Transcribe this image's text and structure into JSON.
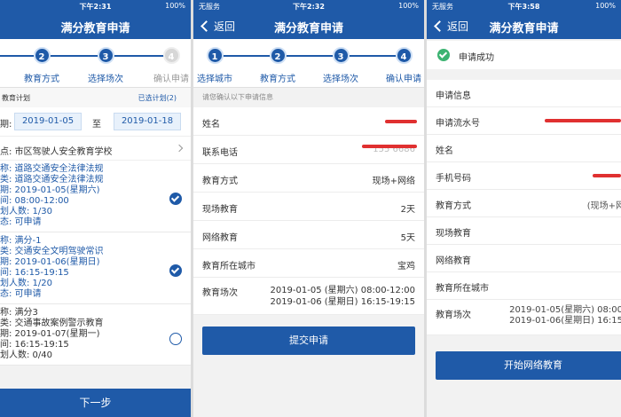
{
  "screen1": {
    "status": {
      "time": "下午2:31",
      "battery": "100%"
    },
    "title": "满分教育申请",
    "steps": [
      {
        "num": "2",
        "label": "教育方式"
      },
      {
        "num": "3",
        "label": "选择场次"
      },
      {
        "num": "4",
        "label": "确认申请"
      }
    ],
    "plan_header": "教育计划",
    "plan_selected": "已选计划(2)",
    "period_label": "期:",
    "date_from": "2019-01-05",
    "date_to_word": "至",
    "date_to": "2019-01-18",
    "school": "点: 市区驾驶人安全教育学校",
    "plans": [
      {
        "lines": [
          "称: 道路交通安全法律法规",
          "类: 道路交通安全法律法规",
          "期: 2019-01-05(星期六)",
          "间: 08:00-12:00",
          "划人数: 1/30",
          "态: 可申请"
        ],
        "checked": true
      },
      {
        "lines": [
          "称: 满分-1",
          "类: 交通安全文明驾驶常识",
          "期: 2019-01-06(星期日)",
          "间: 16:15-19:15",
          "划人数: 1/20",
          "态: 可申请"
        ],
        "checked": true
      },
      {
        "lines": [
          "称: 满分3",
          "类: 交通事故案例警示教育",
          "期: 2019-01-07(星期一)",
          "间: 16:15-19:15",
          "划人数: 0/40"
        ],
        "checked": false
      }
    ],
    "next_button": "下一步"
  },
  "screen2": {
    "status": {
      "carrier": "无服务",
      "time": "下午2:32",
      "battery": "100%"
    },
    "back": "返回",
    "title": "满分教育申请",
    "steps": [
      {
        "num": "1",
        "label": "选择城市"
      },
      {
        "num": "2",
        "label": "教育方式"
      },
      {
        "num": "3",
        "label": "选择场次"
      },
      {
        "num": "4",
        "label": "确认申请"
      }
    ],
    "confirm_hint": "请您确认以下申请信息",
    "fields": [
      {
        "key": "姓名",
        "value": ""
      },
      {
        "key": "联系电话",
        "value": "155 6686"
      },
      {
        "key": "教育方式",
        "value": "现场+网络"
      },
      {
        "key": "现场教育",
        "value": "2天"
      },
      {
        "key": "网络教育",
        "value": "5天"
      },
      {
        "key": "教育所在城市",
        "value": "宝鸡"
      }
    ],
    "schedule_label": "教育场次",
    "schedule": [
      "2019-01-05 (星期六) 08:00-12:00",
      "2019-01-06 (星期日) 16:15-19:15"
    ],
    "submit": "提交申请"
  },
  "screen3": {
    "status": {
      "carrier": "无服务",
      "time": "下午3:58",
      "battery": "100%"
    },
    "back": "返回",
    "title": "满分教育申请",
    "success": "申请成功",
    "fields": [
      {
        "key": "申请信息",
        "value": ""
      },
      {
        "key": "申请流水号",
        "value": ""
      },
      {
        "key": "姓名",
        "value": ""
      },
      {
        "key": "手机号码",
        "value": ""
      },
      {
        "key": "教育方式",
        "value": "(现场+网"
      },
      {
        "key": "现场教育",
        "value": ""
      },
      {
        "key": "网络教育",
        "value": ""
      },
      {
        "key": "教育所在城市",
        "value": ""
      }
    ],
    "schedule_label": "教育场次",
    "schedule": [
      "2019-01-05(星期六) 08:00",
      "2019-01-06(星期日) 16:15"
    ],
    "start": "开始网络教育"
  }
}
